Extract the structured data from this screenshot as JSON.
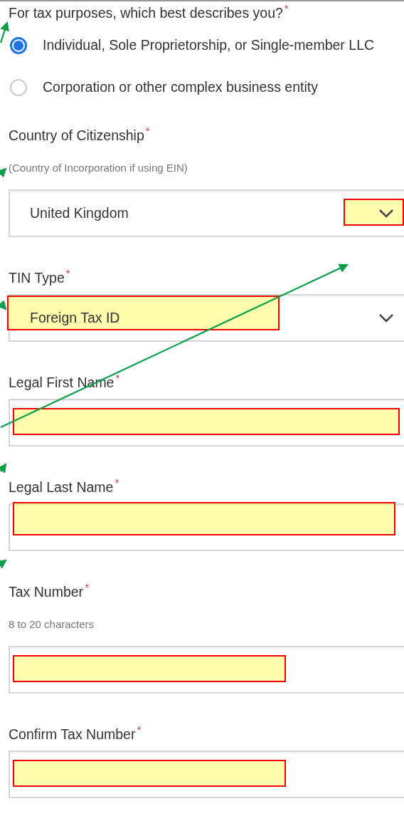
{
  "question": {
    "label": "For tax purposes, which best describes you?",
    "required": "*",
    "options": [
      {
        "label": "Individual, Sole Proprietorship, or Single-member LLC",
        "selected": true
      },
      {
        "label": "Corporation or other complex business entity",
        "selected": false
      }
    ]
  },
  "fields": [
    {
      "kind": "select",
      "label": "Country of Citizenship",
      "required": "*",
      "hint": "(Country of Incorporation if using EIN)",
      "value": "United Kingdom",
      "highlighted": true
    },
    {
      "kind": "select",
      "label": "TIN Type",
      "required": "*",
      "value": "Foreign Tax ID",
      "highlighted": true
    },
    {
      "kind": "input",
      "label": "Legal First Name",
      "required": "*",
      "highlighted": true
    },
    {
      "kind": "input",
      "label": "Legal Last Name",
      "required": "*",
      "highlighted": true
    },
    {
      "kind": "input",
      "label": "Tax Number",
      "required": "*",
      "hint": "8 to 20 characters",
      "highlighted": true
    },
    {
      "kind": "input",
      "label": "Confirm Tax Number",
      "required": "*",
      "highlighted": true
    }
  ]
}
